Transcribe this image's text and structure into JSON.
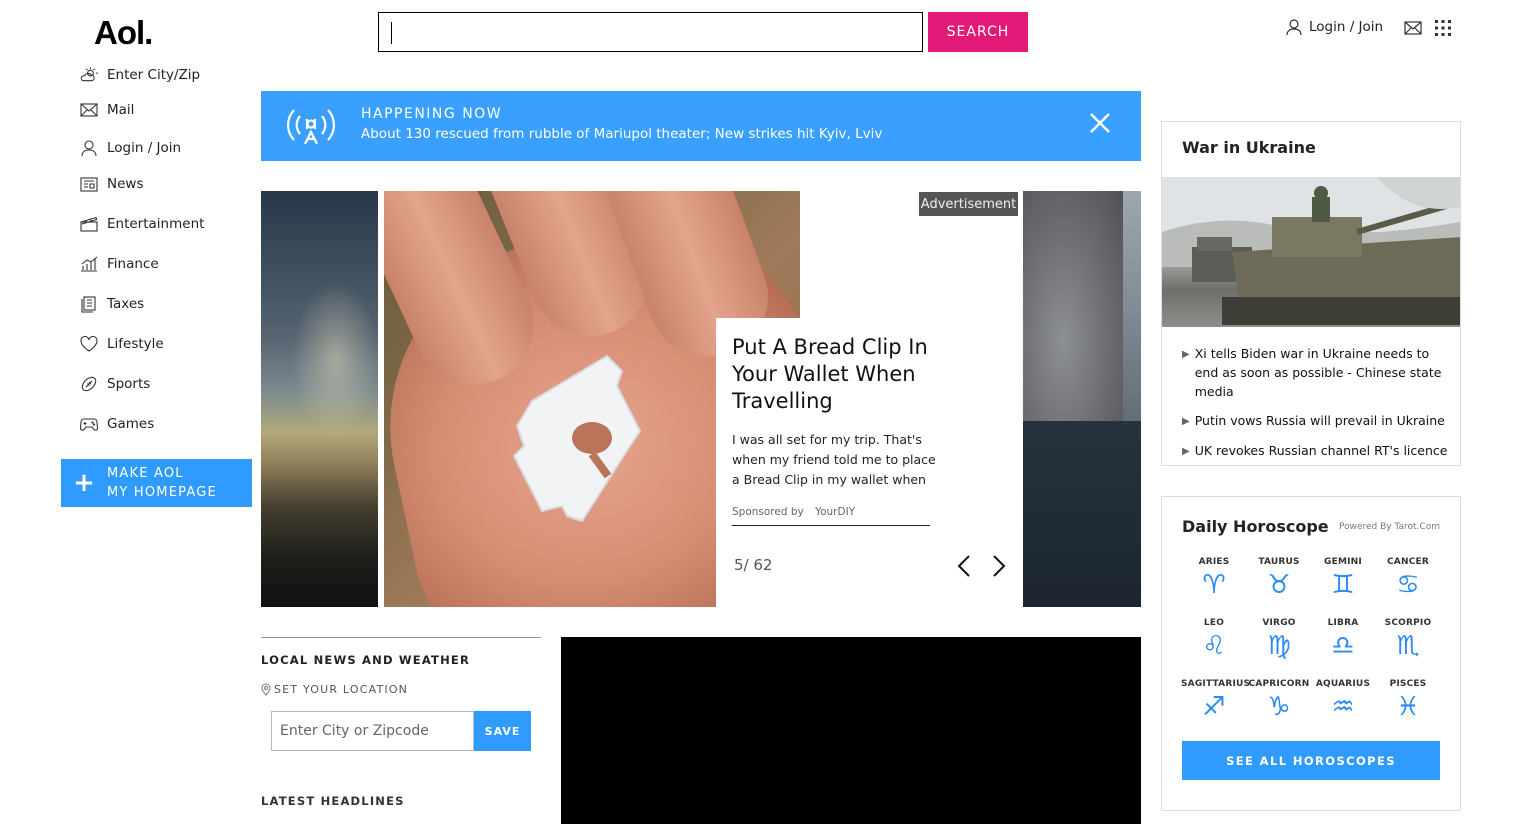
{
  "header": {
    "logo": "Aol.",
    "search_placeholder": "",
    "search_button": "SEARCH",
    "login": "Login / Join"
  },
  "sidebar": {
    "items": [
      {
        "label": "Enter City/Zip",
        "icon": "weather-icon"
      },
      {
        "label": "Mail",
        "icon": "mail-icon"
      },
      {
        "label": "Login / Join",
        "icon": "user-icon"
      },
      {
        "label": "News",
        "icon": "news-icon"
      },
      {
        "label": "Entertainment",
        "icon": "clapperboard-icon"
      },
      {
        "label": "Finance",
        "icon": "chart-icon"
      },
      {
        "label": "Taxes",
        "icon": "document-icon"
      },
      {
        "label": "Lifestyle",
        "icon": "heart-icon"
      },
      {
        "label": "Sports",
        "icon": "football-icon"
      },
      {
        "label": "Games",
        "icon": "gamepad-icon"
      }
    ],
    "homepage_line1": "MAKE AOL",
    "homepage_line2": "MY HOMEPAGE"
  },
  "happening": {
    "title": "HAPPENING NOW",
    "headline": "About 130 rescued from rubble of Mariupol theater; New strikes hit Kyiv, Lviv"
  },
  "carousel": {
    "ad_label": "Advertisement",
    "headline": "Put A Bread Clip In Your Wallet When Travelling",
    "description": "I was all set for my trip. That's when my friend told me to place a Bread Clip in my wallet when traveling. The reason is quite",
    "sponsored_prefix": "Sponsored by",
    "sponsor": "YourDIY",
    "current": "5",
    "total": "/ 62"
  },
  "local": {
    "title": "LOCAL NEWS AND WEATHER",
    "set_location": "SET YOUR LOCATION",
    "zip_placeholder": "Enter City or Zipcode",
    "save": "SAVE",
    "latest": "LATEST HEADLINES"
  },
  "war": {
    "title": "War in Ukraine",
    "items": [
      "Xi tells Biden war in Ukraine needs to end as soon as possible - Chinese state media",
      "Putin vows Russia will prevail in Ukraine",
      "UK revokes Russian channel RT's licence"
    ]
  },
  "horoscope": {
    "title": "Daily Horoscope",
    "powered": "Powered By Tarot.Com",
    "signs": [
      {
        "name": "ARIES",
        "glyph": "♈"
      },
      {
        "name": "TAURUS",
        "glyph": "♉"
      },
      {
        "name": "GEMINI",
        "glyph": "♊"
      },
      {
        "name": "CANCER",
        "glyph": "♋"
      },
      {
        "name": "LEO",
        "glyph": "♌"
      },
      {
        "name": "VIRGO",
        "glyph": "♍"
      },
      {
        "name": "LIBRA",
        "glyph": "♎"
      },
      {
        "name": "SCORPIO",
        "glyph": "♏"
      },
      {
        "name": "SAGITTARIUS",
        "glyph": "♐"
      },
      {
        "name": "CAPRICORN",
        "glyph": "♑"
      },
      {
        "name": "AQUARIUS",
        "glyph": "♒"
      },
      {
        "name": "PISCES",
        "glyph": "♓"
      }
    ],
    "button": "SEE ALL HOROSCOPES"
  },
  "colors": {
    "accent_blue": "#2f9bff",
    "search_pink": "#e3197a"
  }
}
